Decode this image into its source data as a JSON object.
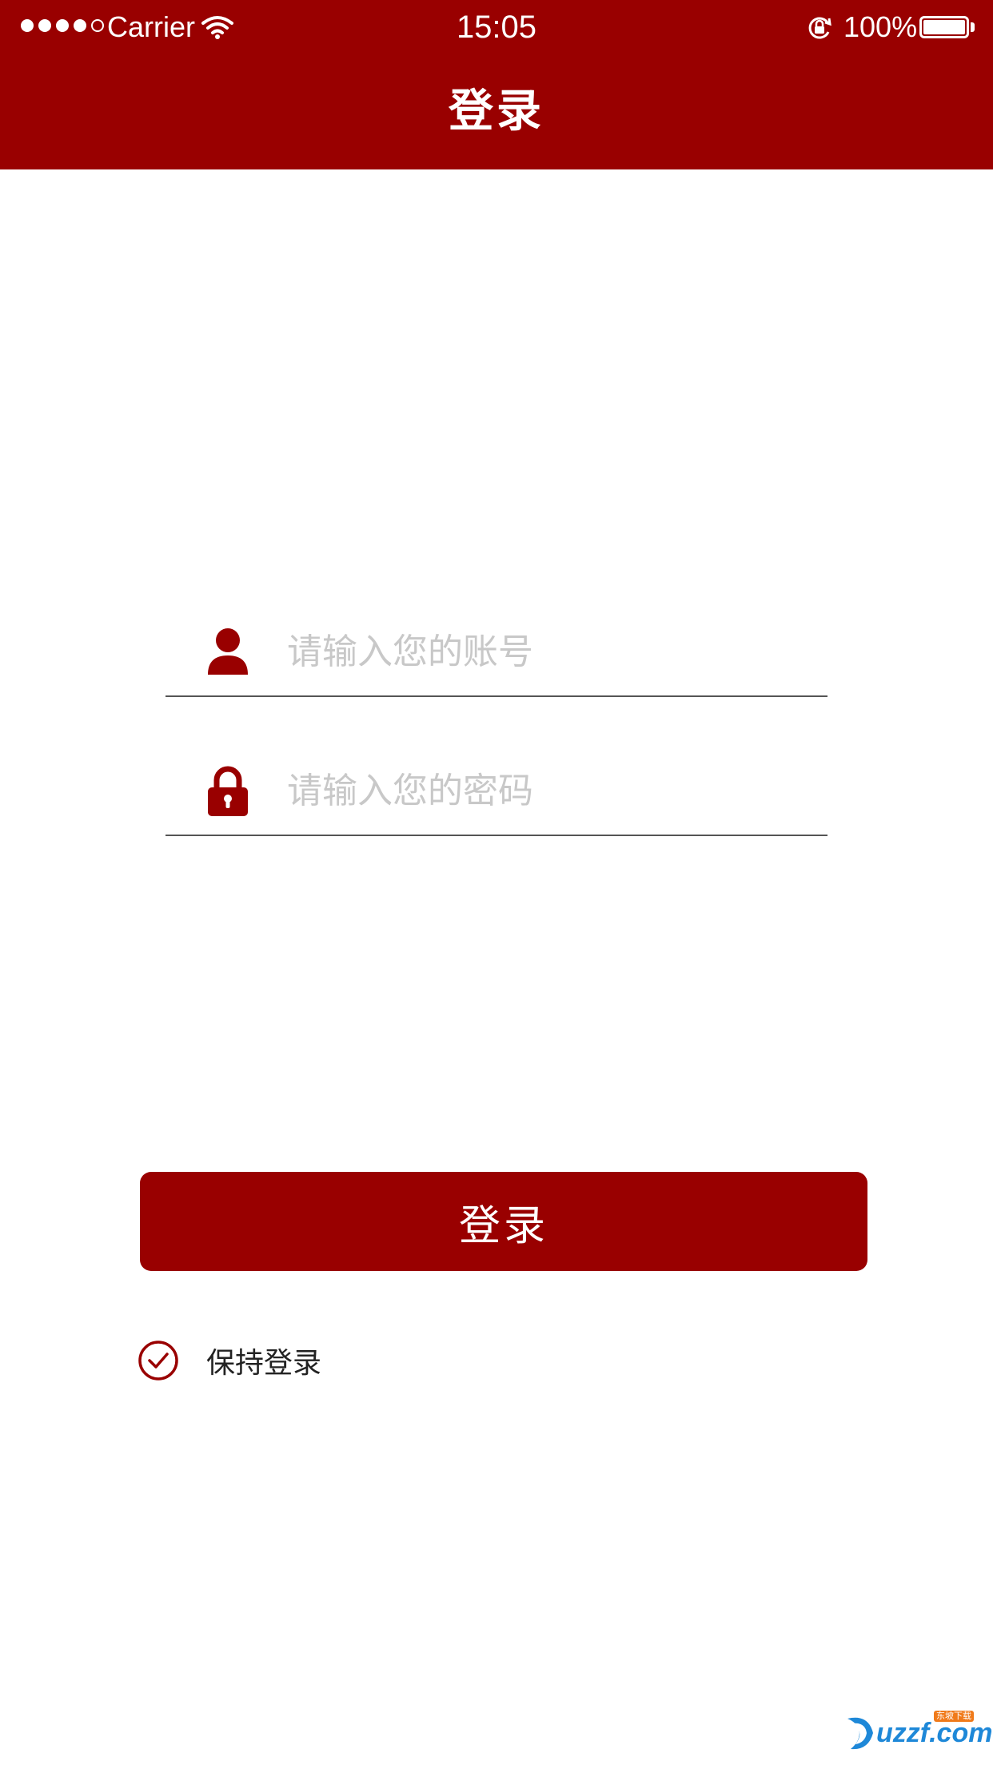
{
  "theme": {
    "accent": "#990000",
    "placeholder_color": "#c8c8c8",
    "divider_color": "#555555"
  },
  "status_bar": {
    "carrier": "Carrier",
    "time": "15:05",
    "battery_percent": "100%",
    "signal_icon": "signal-dots-icon",
    "wifi_icon": "wifi-icon",
    "rotation_icon": "rotation-lock-icon",
    "battery_icon": "battery-icon"
  },
  "nav": {
    "title": "登录"
  },
  "form": {
    "account": {
      "icon": "user-icon",
      "value": "",
      "placeholder": "请输入您的账号"
    },
    "password": {
      "icon": "lock-icon",
      "value": "",
      "placeholder": "请输入您的密码"
    },
    "login_button_label": "登录",
    "keep_logged_in": {
      "label": "保持登录",
      "checked": true,
      "icon": "check-circle-icon"
    }
  },
  "watermark": {
    "text": "uzzf.com",
    "tag": "东坡下载",
    "icon": "uzzf-logo-icon"
  }
}
